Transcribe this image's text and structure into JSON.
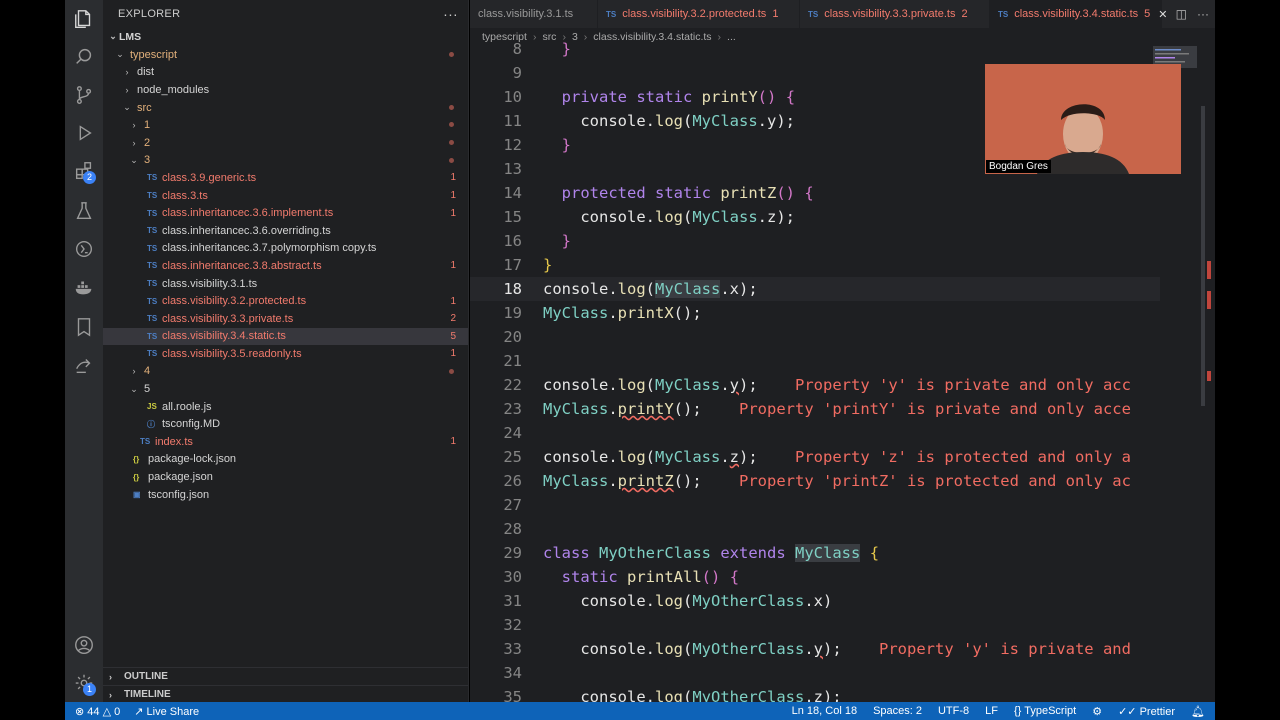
{
  "explorer": {
    "title": "EXPLORER",
    "root": "LMS",
    "rows": [
      {
        "label": "typescript",
        "indent": 1,
        "kind": "folder-open",
        "color": "orange",
        "dot": true
      },
      {
        "label": "dist",
        "indent": 2,
        "kind": "folder",
        "color": ""
      },
      {
        "label": "node_modules",
        "indent": 2,
        "kind": "folder",
        "color": ""
      },
      {
        "label": "src",
        "indent": 2,
        "kind": "folder-open",
        "color": "orange",
        "dot": true
      },
      {
        "label": "1",
        "indent": 3,
        "kind": "folder",
        "color": "orange",
        "dot": true
      },
      {
        "label": "2",
        "indent": 3,
        "kind": "folder",
        "color": "orange",
        "dot": true
      },
      {
        "label": "3",
        "indent": 3,
        "kind": "folder-open",
        "color": "orange",
        "dot": true
      },
      {
        "label": "class.3.9.generic.ts",
        "indent": 4,
        "kind": "ts",
        "color": "err",
        "count": "1"
      },
      {
        "label": "class.3.ts",
        "indent": 4,
        "kind": "ts",
        "color": "err",
        "count": "1"
      },
      {
        "label": "class.inheritancec.3.6.implement.ts",
        "indent": 4,
        "kind": "ts",
        "color": "err",
        "count": "1"
      },
      {
        "label": "class.inheritancec.3.6.overriding.ts",
        "indent": 4,
        "kind": "ts",
        "color": ""
      },
      {
        "label": "class.inheritancec.3.7.polymorphism copy.ts",
        "indent": 4,
        "kind": "ts",
        "color": ""
      },
      {
        "label": "class.inheritancec.3.8.abstract.ts",
        "indent": 4,
        "kind": "ts",
        "color": "err",
        "count": "1"
      },
      {
        "label": "class.visibility.3.1.ts",
        "indent": 4,
        "kind": "ts",
        "color": ""
      },
      {
        "label": "class.visibility.3.2.protected.ts",
        "indent": 4,
        "kind": "ts",
        "color": "err",
        "count": "1"
      },
      {
        "label": "class.visibility.3.3.private.ts",
        "indent": 4,
        "kind": "ts",
        "color": "err",
        "count": "2"
      },
      {
        "label": "class.visibility.3.4.static.ts",
        "indent": 4,
        "kind": "ts",
        "color": "err",
        "count": "5",
        "selected": true
      },
      {
        "label": "class.visibility.3.5.readonly.ts",
        "indent": 4,
        "kind": "ts",
        "color": "err",
        "count": "1"
      },
      {
        "label": "4",
        "indent": 3,
        "kind": "folder",
        "color": "orange",
        "dot": true
      },
      {
        "label": "5",
        "indent": 3,
        "kind": "folder-open",
        "color": ""
      },
      {
        "label": "all.roole.js",
        "indent": 4,
        "kind": "js",
        "color": ""
      },
      {
        "label": "tsconfig.MD",
        "indent": 4,
        "kind": "md",
        "color": ""
      },
      {
        "label": "index.ts",
        "indent": 3,
        "kind": "ts",
        "color": "err",
        "count": "1"
      },
      {
        "label": "package-lock.json",
        "indent": 2,
        "kind": "json",
        "color": ""
      },
      {
        "label": "package.json",
        "indent": 2,
        "kind": "json",
        "color": ""
      },
      {
        "label": "tsconfig.json",
        "indent": 2,
        "kind": "tsconfig",
        "color": ""
      }
    ],
    "outline": "OUTLINE",
    "timeline": "TIMELINE"
  },
  "tabs": [
    {
      "label": "class.visibility.3.1.ts",
      "count": "",
      "active": false
    },
    {
      "label": "class.visibility.3.2.protected.ts",
      "count": "1",
      "active": false
    },
    {
      "label": "class.visibility.3.3.private.ts",
      "count": "2",
      "active": false
    },
    {
      "label": "class.visibility.3.4.static.ts",
      "count": "5",
      "active": true
    }
  ],
  "breadcrumb": [
    "typescript",
    "src",
    "3",
    "class.visibility.3.4.static.ts",
    "..."
  ],
  "code_lines": [
    {
      "n": "8",
      "html": "  <span class=\"brace2\">}</span>"
    },
    {
      "n": "9",
      "html": ""
    },
    {
      "n": "10",
      "html": "  <span class=\"kw\">private static</span> <span class=\"fn\">printY</span><span class=\"brace2\">()</span> <span class=\"brace2\">{</span>"
    },
    {
      "n": "11",
      "html": "    console.<span class=\"fn\">log</span>(<span class=\"cls\">MyClass</span>.y);"
    },
    {
      "n": "12",
      "html": "  <span class=\"brace2\">}</span>"
    },
    {
      "n": "13",
      "html": ""
    },
    {
      "n": "14",
      "html": "  <span class=\"kw\">protected static</span> <span class=\"fn\">printZ</span><span class=\"brace2\">()</span> <span class=\"brace2\">{</span>"
    },
    {
      "n": "15",
      "html": "    console.<span class=\"fn\">log</span>(<span class=\"cls\">MyClass</span>.z);"
    },
    {
      "n": "16",
      "html": "  <span class=\"brace2\">}</span>"
    },
    {
      "n": "17",
      "html": "<span class=\"brace1\">}</span>"
    },
    {
      "n": "18",
      "html": "console.<span class=\"fn\">log</span>(<span class=\"cls hl\">MyClass</span>.x);",
      "current": true
    },
    {
      "n": "19",
      "html": "<span class=\"cls\">MyClass</span>.<span class=\"fn\">printX</span>();"
    },
    {
      "n": "20",
      "html": ""
    },
    {
      "n": "21",
      "html": ""
    },
    {
      "n": "22",
      "html": "console.<span class=\"fn\">log</span>(<span class=\"cls\">MyClass</span>.<span class=\"squig\">y</span>);    <span class=\"diag\">Property 'y' is private and only acc</span>"
    },
    {
      "n": "23",
      "html": "<span class=\"cls\">MyClass</span>.<span class=\"fn squig\">printY</span>();    <span class=\"diag\">Property 'printY' is private and only acce</span>"
    },
    {
      "n": "24",
      "html": ""
    },
    {
      "n": "25",
      "html": "console.<span class=\"fn\">log</span>(<span class=\"cls\">MyClass</span>.<span class=\"squig\">z</span>);    <span class=\"diag\">Property 'z' is protected and only a</span>"
    },
    {
      "n": "26",
      "html": "<span class=\"cls\">MyClass</span>.<span class=\"fn squig\">printZ</span>();    <span class=\"diag\">Property 'printZ' is protected and only ac</span>"
    },
    {
      "n": "27",
      "html": ""
    },
    {
      "n": "28",
      "html": ""
    },
    {
      "n": "29",
      "html": "<span class=\"kw\">class</span> <span class=\"cls\">MyOtherClass</span> <span class=\"kw\">extends</span> <span class=\"cls hl\">MyClass</span> <span class=\"brace1\">{</span>"
    },
    {
      "n": "30",
      "html": "  <span class=\"kw\">static</span> <span class=\"fn\">printAll</span><span class=\"brace2\">()</span> <span class=\"brace2\">{</span>"
    },
    {
      "n": "31",
      "html": "    console.<span class=\"fn\">log</span>(<span class=\"cls\">MyOtherClass</span>.x)"
    },
    {
      "n": "32",
      "html": ""
    },
    {
      "n": "33",
      "html": "    console.<span class=\"fn\">log</span>(<span class=\"cls\">MyOtherClass</span>.<span class=\"squig\">y</span>);    <span class=\"diag\">Property 'y' is private and</span>"
    },
    {
      "n": "34",
      "html": ""
    },
    {
      "n": "35",
      "html": "    console.<span class=\"fn\">log</span>(<span class=\"cls\">MyOtherClass</span>.z);"
    }
  ],
  "webcam": {
    "name": "Bogdan Gres"
  },
  "status": {
    "errors": "44",
    "warnings": "0",
    "live_share": "Live Share",
    "position": "Ln 18, Col 18",
    "spaces": "Spaces: 2",
    "encoding": "UTF-8",
    "eol": "LF",
    "language": "TypeScript",
    "prettier": "Prettier"
  },
  "activity_badges": {
    "extensions": "2",
    "accounts": "1"
  },
  "colors": {
    "accent": "#0e63b8",
    "error": "#f27b6d",
    "sidebar": "#1f2022",
    "editor": "#1e1f22"
  }
}
